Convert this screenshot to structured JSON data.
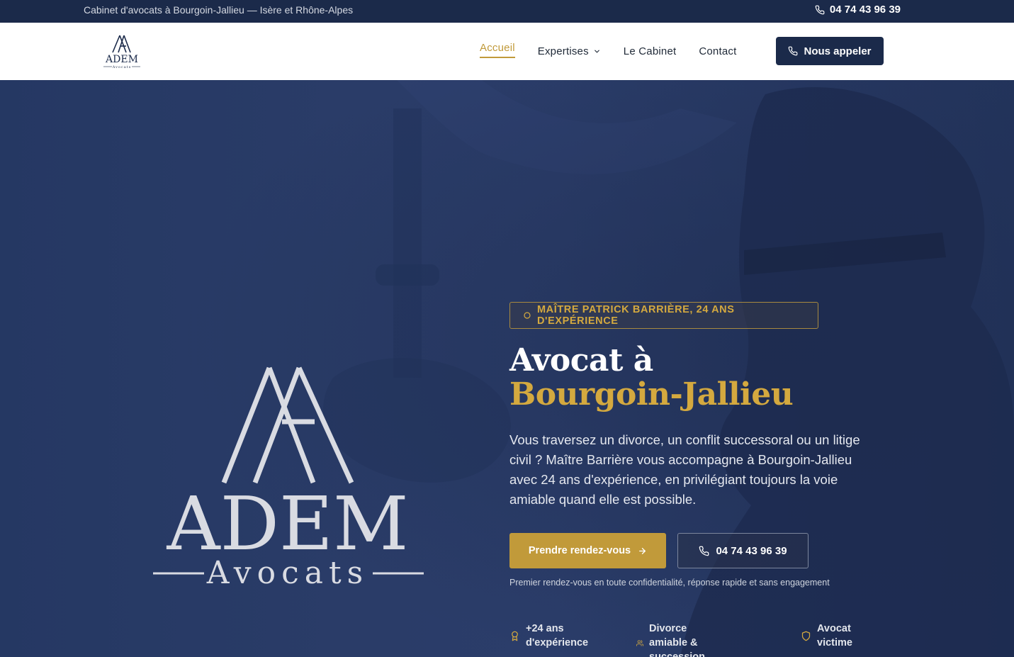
{
  "topbar": {
    "tagline": "Cabinet d'avocats à Bourgoin-Jallieu — Isère et Rhône-Alpes",
    "phone": "04 74 43 96 39"
  },
  "header": {
    "logo": {
      "name": "ADEM",
      "sub": "Avocats"
    },
    "nav": [
      {
        "label": "Accueil",
        "active": true
      },
      {
        "label": "Expertises",
        "has_dropdown": true
      },
      {
        "label": "Le Cabinet"
      },
      {
        "label": "Contact"
      }
    ],
    "call_button": "Nous appeler"
  },
  "hero": {
    "logo": {
      "name": "ADEM",
      "sub": "Avocats"
    },
    "badge": "MAÎTRE PATRICK BARRIÈRE, 24 ANS D'EXPÉRIENCE",
    "title_line1": "Avocat à",
    "title_line2": "Bourgoin-Jallieu",
    "lead": "Vous traversez un divorce, un conflit successoral ou un litige civil ? Maître Barrière vous accompagne à Bourgoin-Jallieu avec 24 ans d'expérience, en privilégiant toujours la voie amiable quand elle est possible.",
    "primary_button": "Prendre rendez-vous",
    "secondary_button": "04 74 43 96 39",
    "note": "Premier rendez-vous en toute confidentialité, réponse rapide et sans engagement",
    "features": [
      {
        "icon": "award-icon",
        "line1": "+24 ans",
        "line2": "d'expérience"
      },
      {
        "icon": "users-icon",
        "line1": "Divorce amiable &",
        "line2": "succession"
      },
      {
        "icon": "shield-icon",
        "line1": "Avocat",
        "line2": "victime"
      }
    ]
  },
  "colors": {
    "navy": "#1b2a4a",
    "gold": "#c19a3a",
    "gold_text": "#d4a93f",
    "hero_bg": "#2a3c68"
  }
}
